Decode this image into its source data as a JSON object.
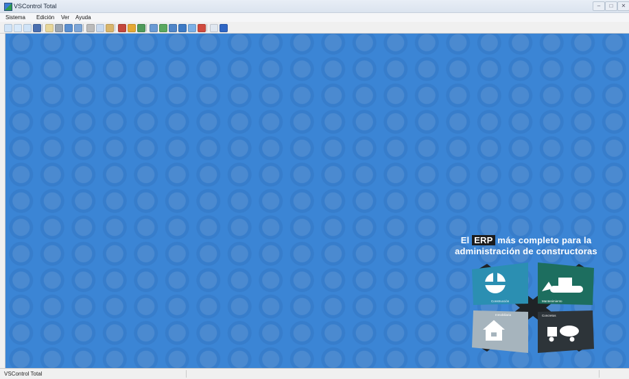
{
  "window": {
    "title": "VSControl Total",
    "min": "–",
    "max": "□",
    "close": "✕"
  },
  "menu": [
    "Sistema",
    "Edición",
    "Ver",
    "Ayuda"
  ],
  "toolbar_icons": [
    {
      "name": "new-doc-icon",
      "color": "#cfe3f7"
    },
    {
      "name": "open-doc-icon",
      "color": "#d8e9fa"
    },
    {
      "name": "copy-doc-icon",
      "color": "#cfe3f7"
    },
    {
      "name": "save-icon",
      "color": "#4a6fb0"
    },
    {
      "name": "search-icon",
      "color": "#e8d79a"
    },
    {
      "name": "print-icon",
      "color": "#9aa5b2"
    },
    {
      "name": "users-icon",
      "color": "#5a8fd0"
    },
    {
      "name": "report-icon",
      "color": "#7da6d8"
    },
    {
      "name": "cut-icon",
      "color": "#bbb"
    },
    {
      "name": "copy-icon",
      "color": "#c7d9ef"
    },
    {
      "name": "paste-icon",
      "color": "#d9b56a"
    },
    {
      "name": "import-icon",
      "color": "#c4473c"
    },
    {
      "name": "export-icon",
      "color": "#e5a833"
    },
    {
      "name": "grid-icon",
      "color": "#4f9a5a"
    },
    {
      "name": "refresh-icon",
      "color": "#6a9ad4"
    },
    {
      "name": "filter-icon",
      "color": "#5aa85f"
    },
    {
      "name": "list-icon",
      "color": "#4f85c8"
    },
    {
      "name": "chart-icon",
      "color": "#3d7ac5"
    },
    {
      "name": "tools-icon",
      "color": "#7bb0e6"
    },
    {
      "name": "remove-icon",
      "color": "#d04a3e"
    },
    {
      "name": "mail-icon",
      "color": "#e0e7f0"
    },
    {
      "name": "help-icon",
      "color": "#2f66c4"
    }
  ],
  "tagline": {
    "prefix": "El",
    "badge": "ERP",
    "line1_rest": "más completo para la",
    "line2": "administración de constructoras"
  },
  "logo_labels": {
    "tl": "Construcción",
    "tr": "Mantenimiento",
    "bl": "Inmobiliaria",
    "br": "Concretos"
  },
  "colors": {
    "desktop": "#3b85d5",
    "teal": "#2b8fb2",
    "green": "#1d6e5f",
    "gray": "#a6b4bd",
    "dark": "#2d3439"
  },
  "status": {
    "text": "VSControl Total"
  }
}
